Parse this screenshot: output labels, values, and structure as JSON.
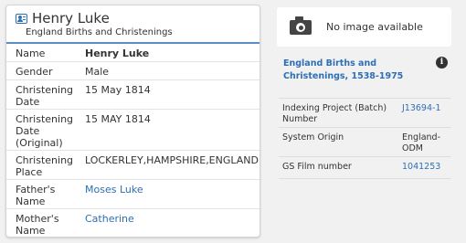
{
  "record": {
    "name": "Henry Luke",
    "collection": "England Births and Christenings",
    "rows": [
      {
        "label": "Name",
        "value": "Henry Luke"
      },
      {
        "label": "Gender",
        "value": "Male"
      },
      {
        "label": "Christening Date",
        "value": "15 May 1814"
      },
      {
        "label": "Christening Date (Original)",
        "value": "15 MAY 1814"
      },
      {
        "label": "Christening Place",
        "value": "LOCKERLEY,HAMPSHIRE,ENGLAND"
      },
      {
        "label": "Father's Name",
        "value": "Moses Luke"
      },
      {
        "label": "Mother's Name",
        "value": "Catherine"
      }
    ]
  },
  "image_panel": {
    "icon": "camera-icon",
    "text": "No image available"
  },
  "source": {
    "collection_title": "England Births and Christenings, 1538-1975",
    "info_icon": "info-icon",
    "info_glyph": "i",
    "rows": [
      {
        "label": "Indexing Project (Batch) Number",
        "value": "J13694-1"
      },
      {
        "label": "System Origin",
        "value": "England-ODM"
      },
      {
        "label": "GS Film number",
        "value": "1041253"
      }
    ]
  },
  "colors": {
    "accent": "#2d6fb5",
    "background": "#f1f1f1"
  }
}
